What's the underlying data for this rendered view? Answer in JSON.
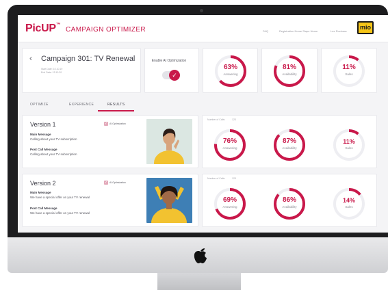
{
  "app": {
    "logo": "PicUP",
    "logo_mark": "™",
    "title": "CAMPAIGN OPTIMIZER",
    "brand_badge": "mio"
  },
  "header_nav": [
    "FAQ",
    "Registration Nome Siape Nome",
    "Lee Ruchaas"
  ],
  "campaign": {
    "title": "Campaign 301: TV Renewal",
    "start_date": "Start Date: 10.10.19",
    "end_date": "End Date: 13.10.20"
  },
  "ai_toggle": {
    "label": "Enable AI Optimization",
    "enabled": true
  },
  "top_metrics": [
    {
      "value": "63%",
      "label": "Answering",
      "percent": 63
    },
    {
      "value": "81%",
      "label": "Availability",
      "percent": 81
    },
    {
      "value": "11%",
      "label": "Sales",
      "percent": 11
    }
  ],
  "tabs": [
    "OPTIMIZE",
    "EXPERIENCE",
    "RESULTS"
  ],
  "active_tab": "RESULTS",
  "versions": [
    {
      "title": "Version 1",
      "ai_label": "AI Optimization",
      "main_label": "Main Message",
      "main_text": "Calling about your TV subscription",
      "post_label": "Post Call Message",
      "post_text": "Calling about your TV subscription",
      "num_calls_label": "Number of Calls:",
      "num_calls": "123",
      "metrics": [
        {
          "value": "76%",
          "label": "Answering",
          "percent": 76
        },
        {
          "value": "87%",
          "label": "Availability",
          "percent": 87
        },
        {
          "value": "11%",
          "label": "Sales",
          "percent": 11
        }
      ]
    },
    {
      "title": "Version 2",
      "ai_label": "AI Optimization",
      "main_label": "Main Message",
      "main_text": "We have a special  offer on your TV renewal",
      "post_label": "Post Call Message",
      "post_text": "We have a special  offer on your TV renewal",
      "num_calls_label": "Number of Calls:",
      "num_calls": "123",
      "metrics": [
        {
          "value": "69%",
          "label": "Answering",
          "percent": 69
        },
        {
          "value": "86%",
          "label": "Availability",
          "percent": 86
        },
        {
          "value": "14%",
          "label": "Sales",
          "percent": 14
        }
      ]
    }
  ],
  "colors": {
    "accent": "#c9184a",
    "track": "#eeeef2",
    "brand_badge": "#f5c518"
  }
}
